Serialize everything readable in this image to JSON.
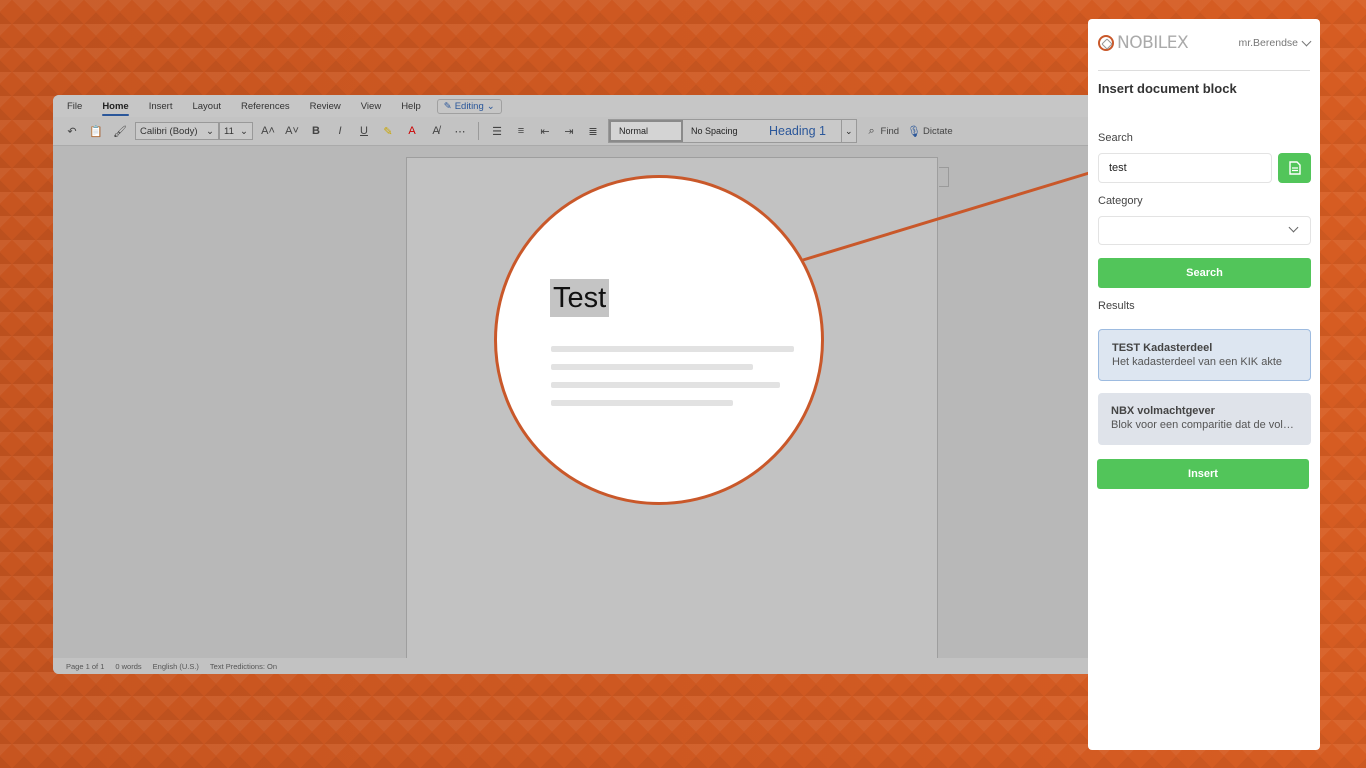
{
  "word": {
    "menu": [
      "File",
      "Home",
      "Insert",
      "Layout",
      "References",
      "Review",
      "View",
      "Help"
    ],
    "active_menu": "Home",
    "editing_label": "Editing",
    "font_name": "Calibri (Body)",
    "font_size": "11",
    "styles": [
      "Normal",
      "No Spacing",
      "Heading 1"
    ],
    "find_label": "Find",
    "dictate_label": "Dictate",
    "status": [
      "Page 1 of 1",
      "0 words",
      "English (U.S.)",
      "Text Predictions: On"
    ]
  },
  "magnifier": {
    "text": "Test"
  },
  "panel": {
    "brand": "NOBILEX",
    "user": "mr.Berendse",
    "title": "Insert document block",
    "search_label": "Search",
    "search_value": "test",
    "category_label": "Category",
    "category_value": "",
    "search_button": "Search",
    "results_label": "Results",
    "results": [
      {
        "title": "TEST Kadasterdeel",
        "description": "Het kadasterdeel van een KIK akte",
        "selected": true
      },
      {
        "title": "NBX volmachtgever",
        "description": "Blok voor een comparitie dat de volm...",
        "selected": false
      }
    ],
    "insert_button": "Insert",
    "colors": {
      "accent": "#52c55a",
      "brand": "#c9582a"
    }
  }
}
